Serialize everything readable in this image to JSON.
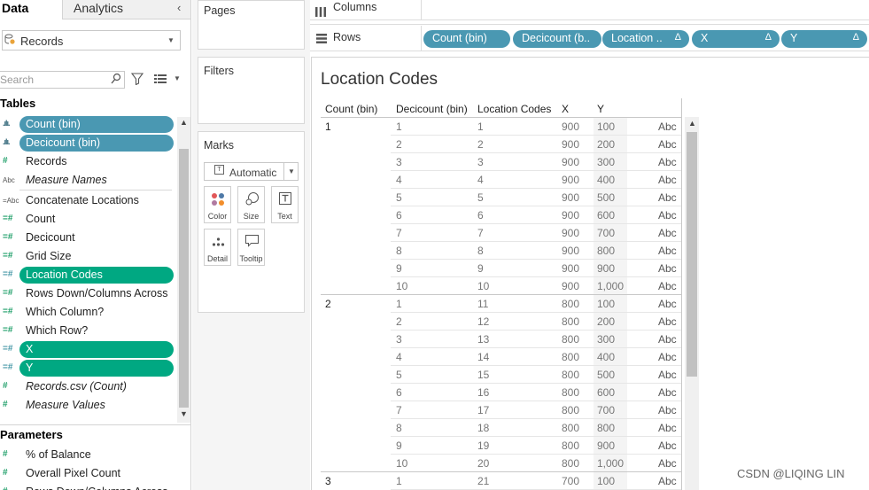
{
  "left_pane": {
    "tab_data": "Data",
    "tab_analytics": "Analytics",
    "collapse_glyph": "‹",
    "datasource": "Records",
    "search_placeholder": "Search",
    "tables_title": "Tables",
    "fields": [
      {
        "icon": ".ılı.",
        "label": "Count (bin)",
        "selected": "blue"
      },
      {
        "icon": ".ılı.",
        "label": "Decicount (bin)",
        "selected": "blue"
      },
      {
        "icon": "#",
        "label": "Records"
      },
      {
        "icon": "Abc",
        "label": "Measure Names",
        "italic": true
      },
      {
        "icon": "=Abc",
        "label": "Concatenate Locations"
      },
      {
        "icon": "=#",
        "label": "Count"
      },
      {
        "icon": "=#",
        "label": "Decicount"
      },
      {
        "icon": "=#",
        "label": "Grid Size"
      },
      {
        "icon": "=#",
        "label": "Location Codes",
        "selected": "green"
      },
      {
        "icon": "=#",
        "label": "Rows Down/Columns Across"
      },
      {
        "icon": "=#",
        "label": "Which Column?"
      },
      {
        "icon": "=#",
        "label": "Which Row?"
      },
      {
        "icon": "=#",
        "label": "X",
        "selected": "green"
      },
      {
        "icon": "=#",
        "label": "Y",
        "selected": "green"
      },
      {
        "icon": "#",
        "label": "Records.csv (Count)",
        "italic": true
      },
      {
        "icon": "#",
        "label": "Measure Values",
        "italic": true
      }
    ],
    "parameters_title": "Parameters",
    "parameters": [
      {
        "icon": "#",
        "label": "% of Balance"
      },
      {
        "icon": "#",
        "label": "Overall Pixel Count"
      },
      {
        "icon": "#",
        "label": "Rows Down/Columns Across"
      }
    ]
  },
  "cards": {
    "pages": "Pages",
    "filters": "Filters",
    "marks": "Marks",
    "mark_type": "Automatic",
    "mark_buttons": [
      "Color",
      "Size",
      "Text",
      "Detail",
      "Tooltip"
    ]
  },
  "shelves": {
    "columns_label": "Columns",
    "rows_label": "Rows",
    "row_pills": [
      {
        "label": "Count (bin)"
      },
      {
        "label": "Decicount (b.."
      },
      {
        "label": "Location ..",
        "delta": "Δ"
      },
      {
        "label": "X",
        "delta": "Δ"
      },
      {
        "label": "Y",
        "delta": "Δ"
      }
    ]
  },
  "viz": {
    "title": "Location Codes",
    "headers": [
      "Count (bin)",
      "Decicount (bin)",
      "Location Codes",
      "X",
      "Y"
    ],
    "abc": "Abc",
    "groups": [
      {
        "count": "1",
        "rows": [
          [
            "1",
            "1",
            "900",
            "100"
          ],
          [
            "2",
            "2",
            "900",
            "200"
          ],
          [
            "3",
            "3",
            "900",
            "300"
          ],
          [
            "4",
            "4",
            "900",
            "400"
          ],
          [
            "5",
            "5",
            "900",
            "500"
          ],
          [
            "6",
            "6",
            "900",
            "600"
          ],
          [
            "7",
            "7",
            "900",
            "700"
          ],
          [
            "8",
            "8",
            "900",
            "800"
          ],
          [
            "9",
            "9",
            "900",
            "900"
          ],
          [
            "10",
            "10",
            "900",
            "1,000"
          ]
        ]
      },
      {
        "count": "2",
        "rows": [
          [
            "1",
            "11",
            "800",
            "100"
          ],
          [
            "2",
            "12",
            "800",
            "200"
          ],
          [
            "3",
            "13",
            "800",
            "300"
          ],
          [
            "4",
            "14",
            "800",
            "400"
          ],
          [
            "5",
            "15",
            "800",
            "500"
          ],
          [
            "6",
            "16",
            "800",
            "600"
          ],
          [
            "7",
            "17",
            "800",
            "700"
          ],
          [
            "8",
            "18",
            "800",
            "800"
          ],
          [
            "9",
            "19",
            "800",
            "900"
          ],
          [
            "10",
            "20",
            "800",
            "1,000"
          ]
        ]
      },
      {
        "count": "3",
        "rows": [
          [
            "1",
            "21",
            "700",
            "100"
          ]
        ]
      }
    ]
  },
  "watermark": "CSDN @LIQING LIN"
}
